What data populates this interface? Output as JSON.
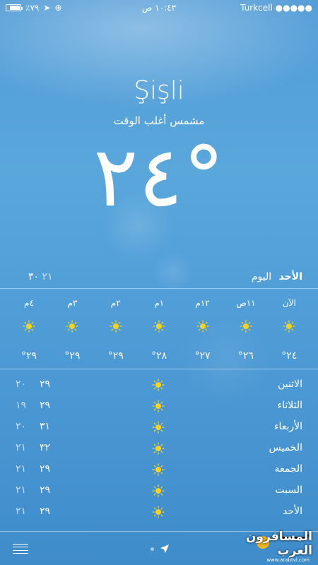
{
  "status_bar": {
    "battery": "٪٧٩",
    "time": "١٠:٤٣ ص",
    "carrier": "Turkcell",
    "signal": "●●●●●"
  },
  "location": {
    "city": "Şişli",
    "condition": "مشمس أغلب الوقت",
    "temperature": "٢٤°"
  },
  "today": {
    "day": "الأحد",
    "label": "اليوم",
    "high": "٣٠",
    "low": "٢١"
  },
  "hourly": [
    {
      "time": "الآن",
      "icon": "sun-icon",
      "temp": "°٢٤"
    },
    {
      "time": "١١ص",
      "icon": "sun-icon",
      "temp": "°٢٦"
    },
    {
      "time": "١٢م",
      "icon": "sun-icon",
      "temp": "°٢٧"
    },
    {
      "time": "١م",
      "icon": "sun-icon",
      "temp": "°٢٨"
    },
    {
      "time": "٢م",
      "icon": "sun-icon",
      "temp": "°٢٩"
    },
    {
      "time": "٣م",
      "icon": "sun-icon",
      "temp": "°٢٩"
    },
    {
      "time": "٤م",
      "icon": "sun-icon",
      "temp": "°٢٩"
    }
  ],
  "daily": [
    {
      "day": "الاثنين",
      "icon": "sun-icon",
      "high": "٢٩",
      "low": "٢٠"
    },
    {
      "day": "الثلاثاء",
      "icon": "sun-icon",
      "high": "٢٩",
      "low": "١٩"
    },
    {
      "day": "الأربعاء",
      "icon": "sun-icon",
      "high": "٣١",
      "low": "٢٠"
    },
    {
      "day": "الخميس",
      "icon": "sun-icon",
      "high": "٣٢",
      "low": "٢١"
    },
    {
      "day": "الجمعة",
      "icon": "sun-icon",
      "high": "٢٩",
      "low": "٢١"
    },
    {
      "day": "السبت",
      "icon": "sun-icon",
      "high": "٢٩",
      "low": "٢١"
    },
    {
      "day": "الأحد",
      "icon": "sun-icon",
      "high": "٢٩",
      "low": "٢١"
    }
  ],
  "watermark": {
    "text": "المسافرون العرب",
    "url": "www.arabtvl.com"
  },
  "colors": {
    "sun": "#f7d21e",
    "sky": "#4f9ad6"
  }
}
